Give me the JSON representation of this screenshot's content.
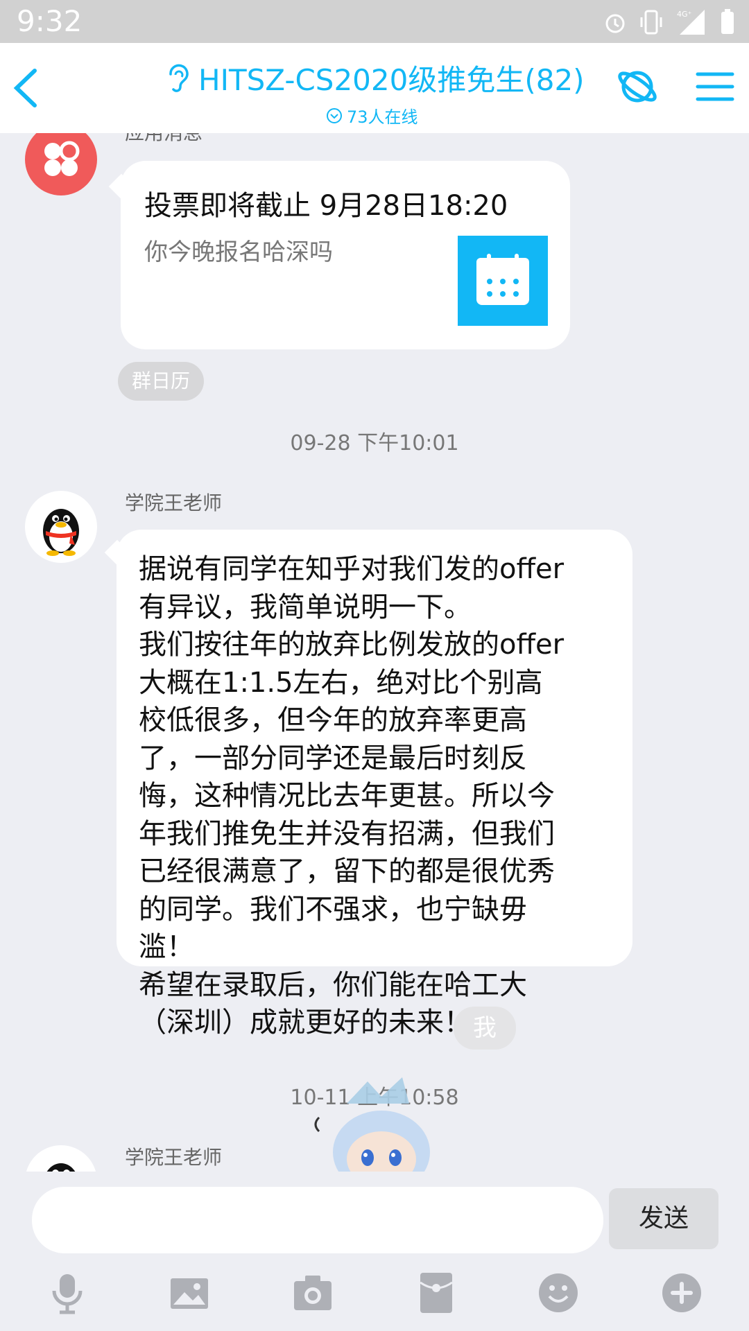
{
  "status_bar": {
    "time": "9:32",
    "network": "4G⁺"
  },
  "header": {
    "title": "HITSZ-CS2020级推免生(82)",
    "online": "73人在线",
    "icons": [
      "back-icon",
      "ear-icon",
      "planet-icon",
      "menu-icon"
    ]
  },
  "messages": [
    {
      "sender": "应用消息",
      "card": {
        "title": "投票即将截止 9月28日18:20",
        "subtitle": "你今晚报名哈深吗",
        "icon": "calendar-icon"
      },
      "tag": "群日历"
    },
    {
      "timestamp": "09-28 下午10:01"
    },
    {
      "sender": "学院王老师",
      "text": "据说有同学在知乎对我们发的offer\n有异议，我简单说明一下。\n我们按往年的放弃比例发放的offer\n大概在1:1.5左右，绝对比个别高\n校低很多，但今年的放弃率更高\n了，一部分同学还是最后时刻反\n悔，这种情况比去年更甚。所以今\n年我们推免生并没有招满，但我们\n已经很满意了，留下的都是很优秀\n的同学。我们不强求，也宁缺毋\n滥！\n希望在录取后，你们能在哈工大\n（深圳）成就更好的未来！"
    },
    {
      "timestamp": "10-11 上午10:58"
    },
    {
      "sender": "学院王老师",
      "partial_bubble": "我"
    }
  ],
  "input_bar": {
    "placeholder": "",
    "send_label": "发送",
    "tools": [
      "mic-icon",
      "image-icon",
      "camera-icon",
      "red-packet-icon",
      "emoji-icon",
      "plus-icon"
    ]
  },
  "colors": {
    "accent": "#12b7f5",
    "background": "#edeef3"
  }
}
